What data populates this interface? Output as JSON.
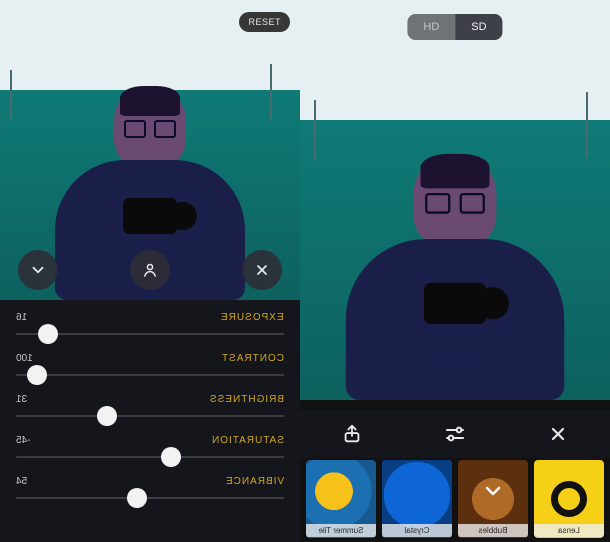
{
  "left": {
    "reset_label": "RESET",
    "buttons": {
      "expand": "chevron-down",
      "subject": "person",
      "close": "close"
    },
    "sliders": [
      {
        "label": "EXPOSURE",
        "value": "16",
        "pos": 12
      },
      {
        "label": "CONTRAST",
        "value": "100",
        "pos": 8
      },
      {
        "label": "BRIGHTNESS",
        "value": "31",
        "pos": 34
      },
      {
        "label": "SATURATION",
        "value": "-45",
        "pos": 58
      },
      {
        "label": "VIBRANCE",
        "value": "54",
        "pos": 45
      }
    ]
  },
  "right": {
    "quality": {
      "hd": "HD",
      "sd": "SD",
      "selected": "SD"
    },
    "actions": {
      "share": "share",
      "adjust": "adjust",
      "close": "close"
    },
    "filters": [
      {
        "name": "Summer Tile",
        "thumb": "t1",
        "selected": false
      },
      {
        "name": "Crystal",
        "thumb": "t2",
        "selected": true
      },
      {
        "name": "Bubbles",
        "thumb": "t3",
        "selected": false
      },
      {
        "name": "Lensa",
        "thumb": "t4",
        "selected": false
      }
    ]
  }
}
